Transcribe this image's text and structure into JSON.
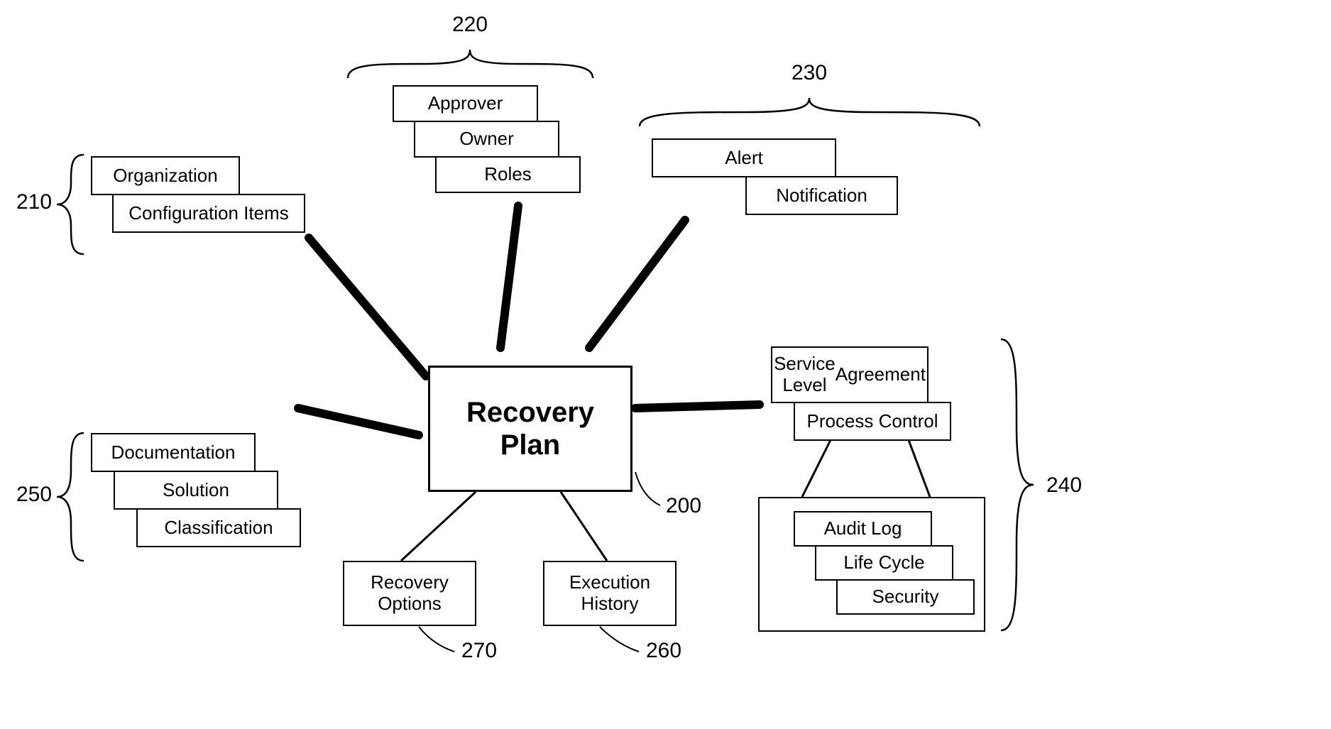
{
  "center": {
    "title_line1": "Recovery",
    "title_line2": "Plan",
    "ref": "200",
    "children": {
      "recovery_options": {
        "label_line1": "Recovery",
        "label_line2": "Options",
        "ref": "270"
      },
      "execution_history": {
        "label_line1": "Execution",
        "label_line2": "History",
        "ref": "260"
      }
    }
  },
  "group210": {
    "ref": "210",
    "items": [
      {
        "label": "Organization"
      },
      {
        "label": "Configuration Items"
      }
    ]
  },
  "group220": {
    "ref": "220",
    "items": [
      {
        "label": "Approver"
      },
      {
        "label": "Owner"
      },
      {
        "label": "Roles"
      }
    ]
  },
  "group230": {
    "ref": "230",
    "items": [
      {
        "label": "Alert"
      },
      {
        "label": "Notification"
      }
    ]
  },
  "group240": {
    "ref": "240",
    "items": [
      {
        "label_line1": "Service Level",
        "label_line2": "Agreement"
      },
      {
        "label": "Process Control"
      }
    ],
    "subitems": [
      {
        "label": "Audit Log"
      },
      {
        "label": "Life Cycle"
      },
      {
        "label": "Security"
      }
    ]
  },
  "group250": {
    "ref": "250",
    "items": [
      {
        "label": "Documentation"
      },
      {
        "label": "Solution"
      },
      {
        "label": "Classification"
      }
    ]
  }
}
